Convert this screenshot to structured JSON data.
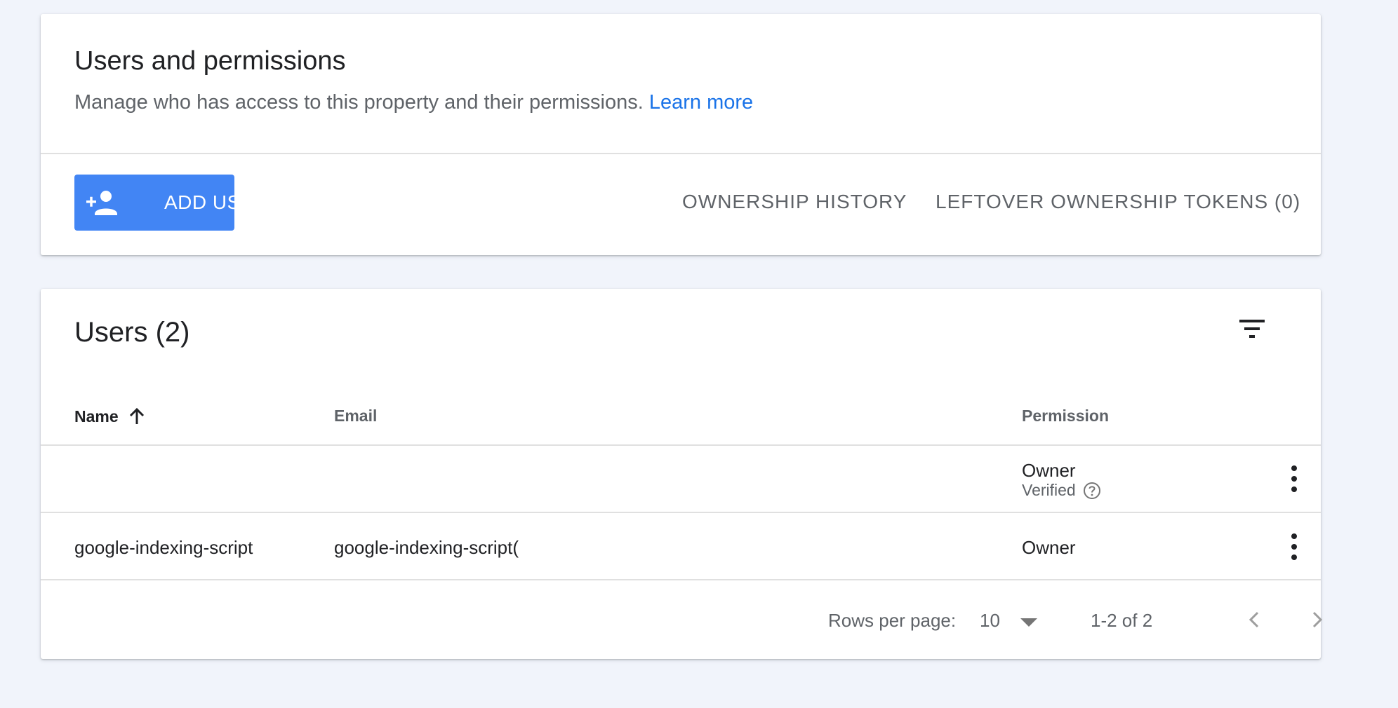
{
  "header": {
    "title": "Users and permissions",
    "subtitle": "Manage who has access to this property and their permissions.",
    "learn_more": "Learn more",
    "add_user_label": "ADD USER",
    "ownership_history_label": "OWNERSHIP HISTORY",
    "leftover_tokens_label": "LEFTOVER OWNERSHIP TOKENS (0)"
  },
  "users": {
    "title": "Users (2)",
    "columns": {
      "name": "Name",
      "email": "Email",
      "permission": "Permission"
    },
    "sort": {
      "column": "name",
      "direction": "ascending"
    },
    "rows": [
      {
        "name": "",
        "email": "",
        "permission": "Owner",
        "status": "Verified"
      },
      {
        "name": "google-indexing-script",
        "email": "google-indexing-script(",
        "permission": "Owner",
        "status": ""
      }
    ]
  },
  "pagination": {
    "rows_per_page_label": "Rows per page:",
    "rows_per_page_value": "10",
    "range": "1-2 of 2"
  },
  "icons": {
    "add_user": "person-add-icon",
    "filter": "filter-icon",
    "sort": "arrow-up-icon",
    "help": "help-outline-icon",
    "more": "more-vert-icon",
    "prev": "chevron-left-icon",
    "next": "chevron-right-icon"
  },
  "colors": {
    "accent": "#4285f4",
    "link": "#1a73e8",
    "background": "#f1f4fb"
  }
}
